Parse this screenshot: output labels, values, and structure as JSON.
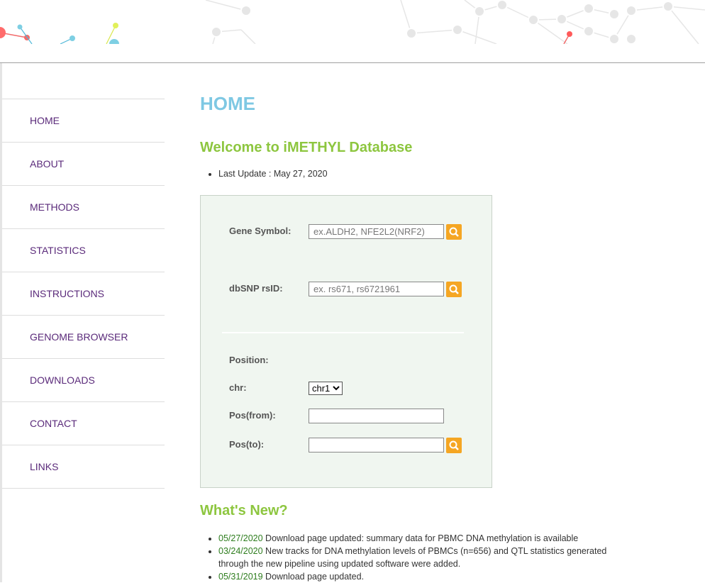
{
  "nav": [
    "HOME",
    "ABOUT",
    "METHODS",
    "STATISTICS",
    "INSTRUCTIONS",
    "GENOME BROWSER",
    "DOWNLOADS",
    "CONTACT",
    "LINKS"
  ],
  "page_title": "HOME",
  "welcome_title": "Welcome to iMETHYL Database",
  "last_update": "Last Update : May 27, 2020",
  "search": {
    "gene_label": "Gene Symbol:",
    "gene_placeholder": "ex.ALDH2, NFE2L2(NRF2)",
    "snp_label": "dbSNP rsID:",
    "snp_placeholder": "ex. rs671, rs6721961",
    "position_label": "Position:",
    "chr_label": "chr:",
    "chr_value": "chr1",
    "from_label": "Pos(from):",
    "to_label": "Pos(to):",
    "search_icon": "magnifier-icon",
    "accent": "#f5a623"
  },
  "whats_new_title": "What's New?",
  "news": [
    {
      "date": "05/27/2020",
      "text": " Download page updated: summary data for PBMC DNA methylation is available"
    },
    {
      "date": "03/24/2020",
      "text": " New tracks for DNA methylation levels of PBMCs (n=656) and QTL statistics generated",
      "text2": "through the new pipeline using updated software were added."
    },
    {
      "date": "05/31/2019",
      "text": " Download page updated."
    }
  ]
}
